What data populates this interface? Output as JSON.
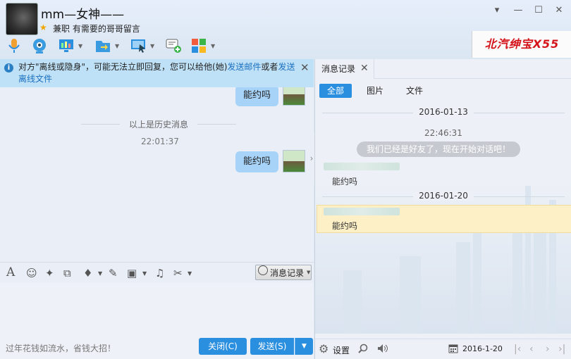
{
  "header": {
    "contact_name": "mm—女神——",
    "signature": "兼职 有需要的哥哥留言",
    "ad_banner": "北汽绅宝X55",
    "window_buttons": [
      "▾",
      "—",
      "☐",
      "✕"
    ]
  },
  "notice": {
    "text_prefix": "对方\"离线或隐身\"，可能无法立即回复，您可以给他(她)",
    "link_mail": "发送邮件",
    "text_mid": "或者",
    "link_file": "发送离线文件",
    "close": "✕"
  },
  "chat": {
    "messages": [
      {
        "text": "能约吗"
      },
      {
        "text": "能约吗"
      }
    ],
    "history_divider": "以上是历史消息",
    "time": "22:01:37"
  },
  "input_toolbar": {
    "history_button": "消息记录"
  },
  "bottom": {
    "ad_text": "过年花钱如流水，省钱大招！",
    "close_button": "关闭(C)",
    "send_button": "发送(S)"
  },
  "panel": {
    "tab_title": "消息记录",
    "filters": [
      "全部",
      "图片",
      "文件"
    ],
    "date1": "2016-01-13",
    "sys_time": "22:46:31",
    "sys_msg": "我们已经是好友了，现在开始对话吧！",
    "entry1_text": "能约吗",
    "date2": "2016-01-20",
    "entry2_text": "能约吗",
    "settings_label": "设置",
    "current_date": "2016-1-20"
  },
  "colors": {
    "accent": "#2b8fe0",
    "bubble": "#a7d3f9",
    "notice_bg": "#bfe1f7",
    "highlight": "#fdf0c6"
  }
}
